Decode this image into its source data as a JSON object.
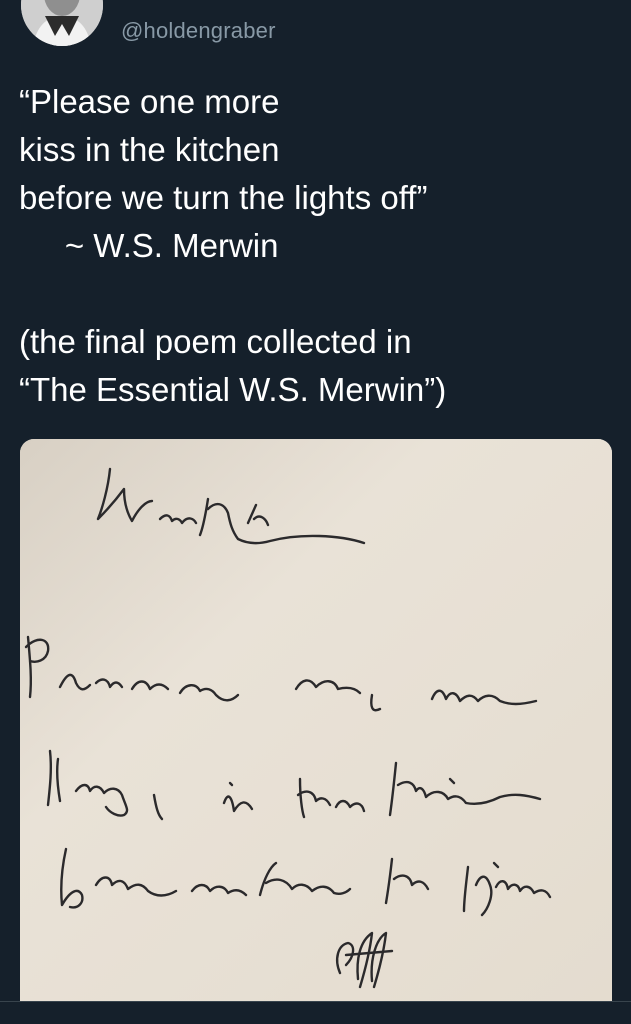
{
  "tweet": {
    "handle": "@holdengraber",
    "lines": [
      "“Please one more",
      "kiss in the kitchen",
      "before we turn the lights off”",
      "     ~ W.S. Merwin",
      "(the final poem collected in",
      "“The Essential W.S. Merwin”)"
    ]
  },
  "colors": {
    "background": "#15202b",
    "handle": "#8899a6",
    "text": "#ffffff",
    "paper": "#e7dfd3",
    "ink": "#2b2a2c"
  },
  "icons": {
    "avatar": "profile-photo",
    "image": "handwritten-manuscript"
  }
}
